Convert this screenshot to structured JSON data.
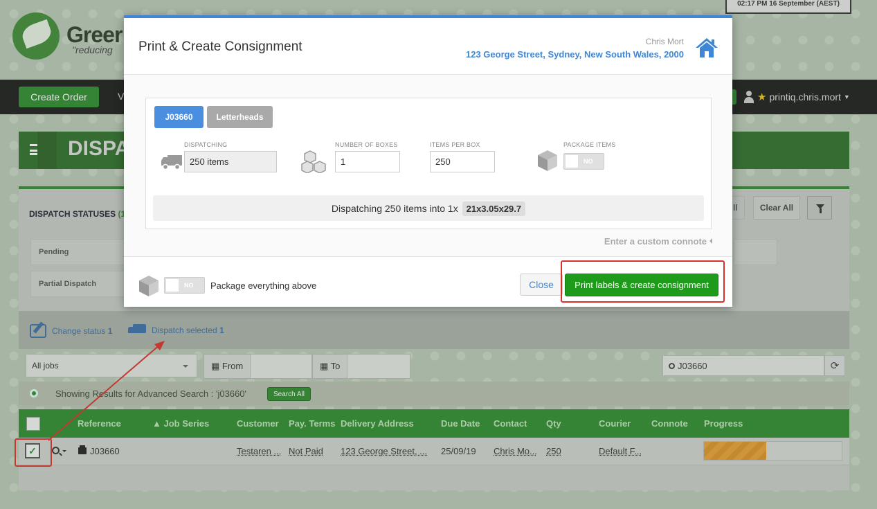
{
  "header": {
    "clock": "02:17 PM  16 September (AEST)",
    "logo_text": "Greer",
    "logo_tagline": "\"reducing"
  },
  "nav": {
    "create_order_label": "Create Order",
    "partial_item": "V",
    "user_name": "printiq.chris.mort"
  },
  "page": {
    "title": "DISPA",
    "statuses_title": "DISPATCH STATUSES",
    "statuses_count": "(1",
    "status_items": [
      "Pending",
      "Partial Dispatch"
    ],
    "btn_partial_label": "ll",
    "btn_clear_all": "Clear All"
  },
  "actions": {
    "change_status_label": "Change status",
    "change_status_count": "1",
    "dispatch_selected_label": "Dispatch selected",
    "dispatch_selected_count": "1"
  },
  "filters": {
    "jobs_select": "All jobs",
    "from_label": "From",
    "to_label": "To",
    "search_value": "J03660"
  },
  "advanced_search": {
    "text": "Showing Results for Advanced Search : 'j03660'",
    "button": "Search All"
  },
  "table": {
    "headers": [
      "Reference",
      "Job Series",
      "Customer",
      "Pay. Terms",
      "Delivery Address",
      "Due Date",
      "Contact",
      "Qty",
      "Courier",
      "Connote",
      "Progress"
    ],
    "row": {
      "reference": "J03660",
      "customer": "Testaren ...",
      "pay_terms": "Not Paid",
      "delivery_address": "123 George Street, ...",
      "due_date": "25/09/19",
      "contact": "Chris Mo...",
      "qty": "250",
      "courier": "Default F...",
      "progress_fraction": 0.45
    }
  },
  "modal": {
    "title": "Print & Create Consignment",
    "contact_name": "Chris Mort",
    "address": "123 George Street, Sydney, New South Wales, 2000",
    "tabs": [
      "J03660",
      "Letterheads"
    ],
    "dispatching_label": "DISPATCHING",
    "dispatching_value": "250 items",
    "boxes_label": "NUMBER OF BOXES",
    "boxes_value": "1",
    "items_per_box_label": "ITEMS PER BOX",
    "items_per_box_value": "250",
    "package_items_label": "PACKAGE ITEMS",
    "toggle_no": "NO",
    "summary_text": "Dispatching 250 items into 1x",
    "summary_dims": "21x3.05x29.7",
    "custom_connote": "Enter a custom connote",
    "package_everything_label": "Package everything above",
    "close_button": "Close",
    "print_button": "Print labels & create consignment"
  },
  "colors": {
    "accent_blue": "#3f86d6",
    "brand_green": "#2e8a2c",
    "print_green": "#1e9b1a",
    "highlight_red": "#d9302a",
    "progress_orange": "#e9a233"
  }
}
